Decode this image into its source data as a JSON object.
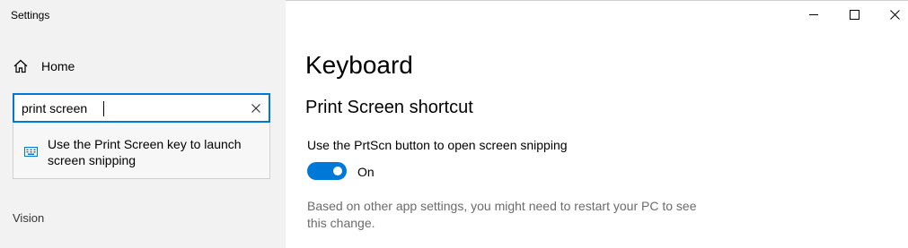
{
  "window": {
    "title": "Settings"
  },
  "sidebar": {
    "home_label": "Home",
    "search": {
      "value": "print screen"
    },
    "suggestions": [
      {
        "text": "Use the Print Screen key to launch screen snipping",
        "icon": "keyboard-icon"
      }
    ],
    "section_label": "Vision"
  },
  "main": {
    "page_title": "Keyboard",
    "section_title": "Print Screen shortcut",
    "setting": {
      "label": "Use the PrtScn button to open screen snipping",
      "state_label": "On",
      "enabled": true
    },
    "note": "Based on other app settings, you might need to restart your PC to see this change."
  },
  "colors": {
    "accent": "#0078d7",
    "sidebar_bg": "#f2f2f2",
    "note_text": "#6b6b6b"
  }
}
